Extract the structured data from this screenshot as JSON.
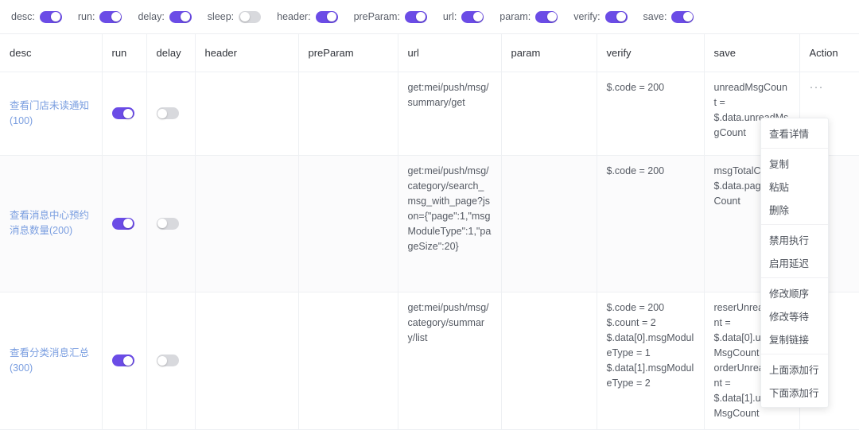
{
  "toggle_bar": {
    "accent_color": "#6b4ce6",
    "off_color": "#d8d9dd",
    "items": [
      {
        "label": "desc:",
        "state": "on"
      },
      {
        "label": "run:",
        "state": "on"
      },
      {
        "label": "delay:",
        "state": "on"
      },
      {
        "label": "sleep:",
        "state": "off"
      },
      {
        "label": "header:",
        "state": "on"
      },
      {
        "label": "preParam:",
        "state": "on"
      },
      {
        "label": "url:",
        "state": "on"
      },
      {
        "label": "param:",
        "state": "on"
      },
      {
        "label": "verify:",
        "state": "on"
      },
      {
        "label": "save:",
        "state": "on"
      }
    ]
  },
  "table": {
    "columns": [
      "desc",
      "run",
      "delay",
      "header",
      "preParam",
      "url",
      "param",
      "verify",
      "save",
      "Action"
    ],
    "rows": [
      {
        "desc": "查看门店未读通知(100)",
        "run": "on",
        "delay": "off",
        "header": "",
        "preParam": "",
        "url": "get:mei/push/msg/summary/get",
        "param": "",
        "verify": "$.code = 200",
        "save": "unreadMsgCount =\n$.data.unreadMsgCount",
        "action": "···"
      },
      {
        "desc": "查看消息中心预约消息数量(200)",
        "run": "on",
        "delay": "off",
        "header": "",
        "preParam": "",
        "url": "get:mei/push/msg/category/search_msg_with_page?json={\"page\":1,\"msgModuleType\":1,\"pageSize\":20}",
        "param": "",
        "verify": "$.code = 200",
        "save": "msgTotalCount =\n$.data.pageTotalCount",
        "action": ""
      },
      {
        "desc": "查看分类消息汇总(300)",
        "run": "on",
        "delay": "off",
        "header": "",
        "preParam": "",
        "url": "get:mei/push/msg/category/summary/list",
        "param": "",
        "verify": "$.code = 200\n$.count = 2\n$.data[0].msgModuleType = 1\n$.data[1].msgModuleType = 2",
        "save": "reserUnreadCount =\n$.data[0].unreadMsgCount\norderUnreadCount =\n$.data[1].unreadMsgCount",
        "action": ""
      }
    ]
  },
  "context_menu": {
    "groups": [
      [
        "查看详情"
      ],
      [
        "复制",
        "粘贴",
        "删除"
      ],
      [
        "禁用执行",
        "启用延迟"
      ],
      [
        "修改顺序",
        "修改等待",
        "复制链接"
      ],
      [
        "上面添加行",
        "下面添加行"
      ]
    ]
  }
}
